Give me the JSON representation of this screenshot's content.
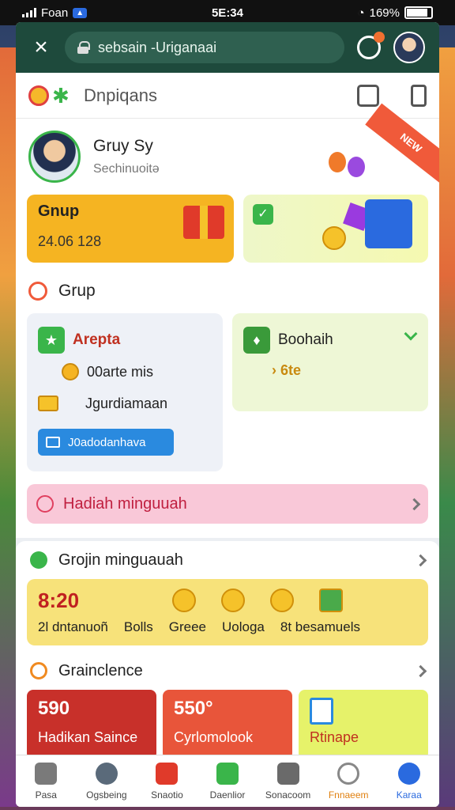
{
  "status_bar": {
    "carrier": "Foan",
    "time": "5E:34",
    "battery": "169%"
  },
  "browser": {
    "url": "sebsain -Uriganaai"
  },
  "app": {
    "title": "Dnpiqans"
  },
  "profile": {
    "name": "Gruy Sy",
    "subtitle": "Sechinuoitə",
    "ribbon": "NEW"
  },
  "top_cards": {
    "left_label": "Gnup",
    "left_value": "24.06 128"
  },
  "section1": {
    "title": "Grup"
  },
  "card_left": {
    "title": "Arepta",
    "line1": "00arte mis",
    "line2": "Jgurdiamaan",
    "button": "J0adodanhava"
  },
  "card_right": {
    "title": "Boohaih",
    "value": "› 6te"
  },
  "pink_bar": {
    "label": "Hadiah minguuah"
  },
  "section2": {
    "title": "Grojin minguauah"
  },
  "yellow_card": {
    "big": "8:20",
    "bottom": "2l dntanuoñ",
    "items": [
      "Bolls",
      "Greee",
      "Uologa",
      "8t besamuels"
    ]
  },
  "section3": {
    "title": "Grainclence"
  },
  "reward_cards": [
    {
      "value": "590",
      "label": "Hadikan Saince"
    },
    {
      "value": "550°",
      "label": "Cyrlomolook"
    },
    {
      "value": "",
      "label": "Rtinape"
    }
  ],
  "tabs": [
    "Pasa",
    "Ogsbeing",
    "Snaotio",
    "Daenlior",
    "Sonacoom",
    "Fnnaeem",
    "Karaa"
  ],
  "colors": {
    "header": "#1e4a3c",
    "accent": "#3ab54a",
    "yellow": "#f5b422",
    "red": "#c8302a"
  }
}
